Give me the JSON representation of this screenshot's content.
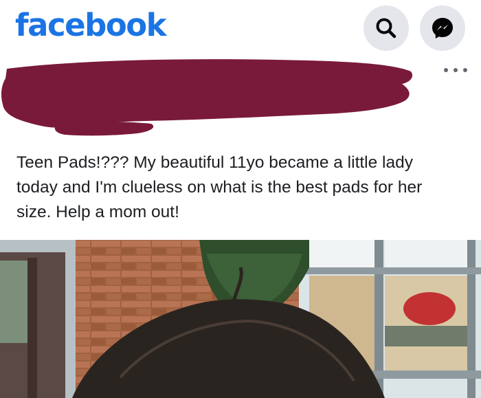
{
  "header": {
    "logo_text": "facebook",
    "search_icon": "search-icon",
    "messenger_icon": "messenger-icon",
    "brand_color": "#1b74e4",
    "button_bg": "#e4e6eb"
  },
  "post": {
    "author_redacted": true,
    "redaction_color": "#7a1a3a",
    "more_icon": "more-options-icon",
    "text": "Teen Pads!??? My beautiful 11yo became a little lady today and I'm clueless on what is the best pads for her size.  Help a mom out!",
    "photo_subject": "photo"
  }
}
